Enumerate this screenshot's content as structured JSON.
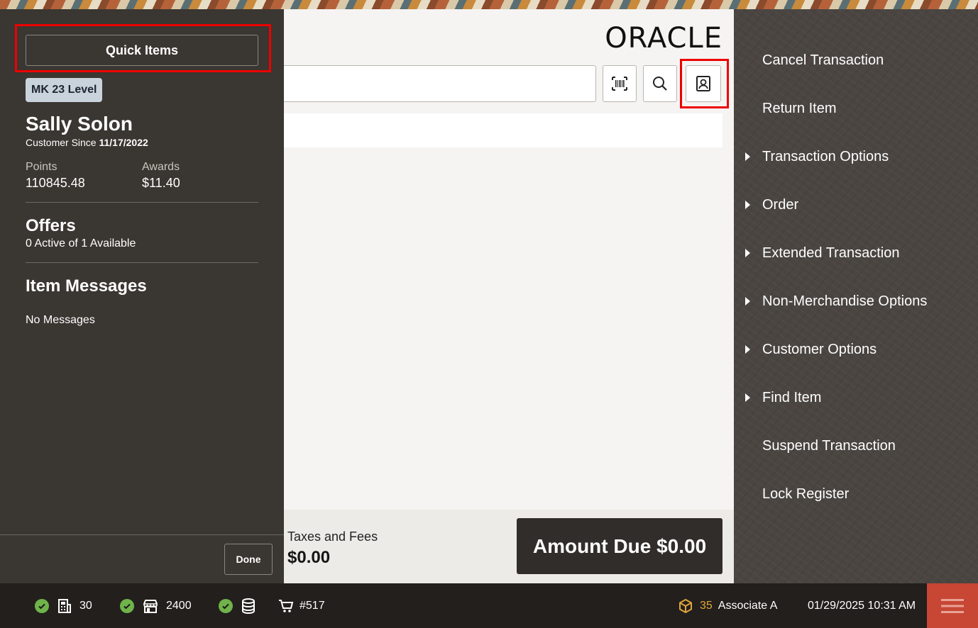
{
  "brand": {
    "logo_text": "ORACLE"
  },
  "customer_panel": {
    "quick_items_label": "Quick Items",
    "level_badge": "MK 23 Level",
    "name": "Sally Solon",
    "customer_since_label": "Customer Since",
    "customer_since_date": "11/17/2022",
    "points_label": "Points",
    "points_value": "110845.48",
    "awards_label": "Awards",
    "awards_value": "$11.40",
    "offers_title": "Offers",
    "offers_subtitle": "0 Active of 1 Available",
    "messages_title": "Item Messages",
    "messages_subtitle": "No Messages",
    "done_label": "Done"
  },
  "search": {
    "placeholder": ""
  },
  "totals": {
    "taxes_label": "Taxes and Fees",
    "taxes_value": "$0.00",
    "amount_due": "Amount Due $0.00"
  },
  "menu": {
    "items": [
      {
        "label": "Cancel Transaction",
        "submenu": false
      },
      {
        "label": "Return Item",
        "submenu": false
      },
      {
        "label": "Transaction Options",
        "submenu": true
      },
      {
        "label": "Order",
        "submenu": true
      },
      {
        "label": "Extended Transaction",
        "submenu": true
      },
      {
        "label": "Non-Merchandise Options",
        "submenu": true
      },
      {
        "label": "Customer Options",
        "submenu": true
      },
      {
        "label": "Find Item",
        "submenu": true
      },
      {
        "label": "Suspend Transaction",
        "submenu": false
      },
      {
        "label": "Lock Register",
        "submenu": false
      }
    ]
  },
  "status_bar": {
    "register": "30",
    "store": "2400",
    "transaction": "#517",
    "cash_drawer_count": "35",
    "associate": "Associate A",
    "datetime": "01/29/2025 10:31 AM"
  },
  "colors": {
    "accent_red": "#c74634",
    "highlight": "#ee0000",
    "status_ok": "#6fb34a",
    "panel_dark": "#3a3631",
    "level_badge": "#c9d3dc"
  }
}
